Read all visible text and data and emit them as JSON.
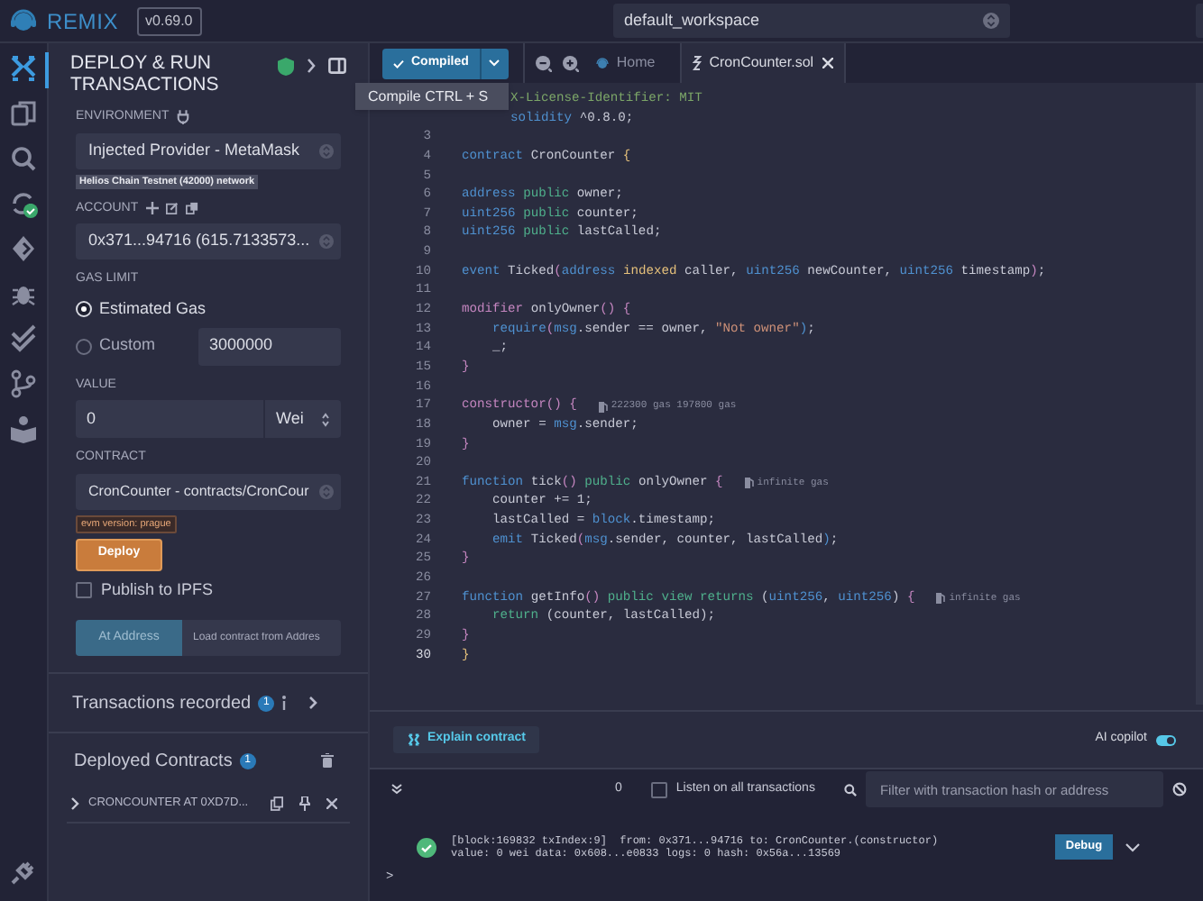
{
  "top_bar": {
    "logo": "REMIX",
    "version": "v0.69.0",
    "workspace": "default_workspace"
  },
  "side_panel": {
    "title": "DEPLOY & RUN TRANSACTIONS",
    "environment": {
      "label": "ENVIRONMENT",
      "value": "Injected Provider - MetaMask",
      "network": "Helios Chain Testnet (42000) network"
    },
    "account": {
      "label": "ACCOUNT",
      "value": "0x371...94716 (615.7133573..."
    },
    "gas_limit": {
      "label": "GAS LIMIT",
      "options": [
        {
          "label": "Estimated Gas",
          "selected": true
        },
        {
          "label": "Custom",
          "selected": false
        }
      ],
      "custom_value": "3000000"
    },
    "value": {
      "label": "VALUE",
      "amount": "0",
      "unit": "Wei"
    },
    "contract": {
      "label": "CONTRACT",
      "value": "CronCounter - contracts/CronCour",
      "evm_badge": "evm version: prague"
    },
    "deploy_button": "Deploy",
    "publish": {
      "label": "Publish to IPFS",
      "checked": false
    },
    "at_address": {
      "button": "At Address",
      "placeholder": "Load contract from Addres"
    },
    "transactions_recorded": {
      "label": "Transactions recorded",
      "count": "1"
    },
    "deployed_contracts": {
      "label": "Deployed Contracts",
      "count": "1",
      "items": [
        {
          "name": "CRONCOUNTER AT 0XD7D..."
        }
      ]
    }
  },
  "editor": {
    "compile_button": "Compiled",
    "tooltip": "Compile CTRL + S",
    "tabs": [
      {
        "label": "Home",
        "selected": false
      },
      {
        "label": "CronCounter.sol",
        "selected": true
      }
    ],
    "lines": [
      {
        "tokens": [
          {
            "text": "X-License-Identifier: MIT",
            "kind": "comment"
          }
        ]
      },
      {
        "tokens": [
          {
            "text": "solidity",
            "kind": "type"
          },
          {
            "text": " ^0.8.0;",
            "kind": "plain"
          }
        ]
      },
      {
        "number": "3"
      },
      {
        "number": "4",
        "tokens": [
          {
            "text": "contract",
            "kind": "type"
          },
          {
            "text": " CronCounter ",
            "kind": "plain"
          },
          {
            "text": "{",
            "kind": "bracket"
          }
        ]
      },
      {
        "number": "5"
      },
      {
        "number": "6",
        "tokens": [
          {
            "text": "address",
            "kind": "type"
          },
          {
            "text": " public",
            "kind": "visibility"
          },
          {
            "text": " owner;",
            "kind": "plain"
          }
        ]
      },
      {
        "number": "7",
        "tokens": [
          {
            "text": "uint256",
            "kind": "type"
          },
          {
            "text": " public",
            "kind": "visibility"
          },
          {
            "text": " counter;",
            "kind": "plain"
          }
        ]
      },
      {
        "number": "8",
        "tokens": [
          {
            "text": "uint256",
            "kind": "type"
          },
          {
            "text": " public",
            "kind": "visibility"
          },
          {
            "text": " lastCalled;",
            "kind": "plain"
          }
        ]
      },
      {
        "number": "9"
      },
      {
        "number": "10",
        "tokens": [
          {
            "text": "event",
            "kind": "type"
          },
          {
            "text": " Ticked",
            "kind": "plain"
          },
          {
            "text": "(",
            "kind": "paren"
          },
          {
            "text": "address",
            "kind": "type"
          },
          {
            "text": " indexed",
            "kind": "bracket"
          },
          {
            "text": " caller, ",
            "kind": "plain"
          },
          {
            "text": "uint256",
            "kind": "type"
          },
          {
            "text": " newCounter, ",
            "kind": "plain"
          },
          {
            "text": "uint256",
            "kind": "type"
          },
          {
            "text": " timestamp",
            "kind": "plain"
          },
          {
            "text": ")",
            "kind": "paren"
          },
          {
            "text": ";",
            "kind": "plain"
          }
        ]
      },
      {
        "number": "11"
      },
      {
        "number": "12",
        "tokens": [
          {
            "text": "modifier",
            "kind": "paren"
          },
          {
            "text": " onlyOwner",
            "kind": "plain"
          },
          {
            "text": "()",
            "kind": "paren"
          },
          {
            "text": " {",
            "kind": "paren"
          }
        ]
      },
      {
        "number": "13",
        "tokens": [
          {
            "text": "    require",
            "kind": "type"
          },
          {
            "text": "(",
            "kind": "paren"
          },
          {
            "text": "msg",
            "kind": "type"
          },
          {
            "text": ".sender == owner, ",
            "kind": "plain"
          },
          {
            "text": "\"Not owner\"",
            "kind": "string"
          },
          {
            "text": ")",
            "kind": "type"
          },
          {
            "text": ";",
            "kind": "plain"
          }
        ]
      },
      {
        "number": "14",
        "tokens": [
          {
            "text": "    _;",
            "kind": "plain"
          }
        ]
      },
      {
        "number": "15",
        "tokens": [
          {
            "text": "}",
            "kind": "paren"
          }
        ]
      },
      {
        "number": "16"
      },
      {
        "number": "17",
        "tokens": [
          {
            "text": "constructor",
            "kind": "paren"
          },
          {
            "text": "() {",
            "kind": "paren"
          }
        ],
        "hint": "222300 gas 197800 gas"
      },
      {
        "number": "18",
        "tokens": [
          {
            "text": "    owner = ",
            "kind": "plain"
          },
          {
            "text": "msg",
            "kind": "type"
          },
          {
            "text": ".sender;",
            "kind": "plain"
          }
        ]
      },
      {
        "number": "19",
        "tokens": [
          {
            "text": "}",
            "kind": "paren"
          }
        ]
      },
      {
        "number": "20"
      },
      {
        "number": "21",
        "tokens": [
          {
            "text": "function",
            "kind": "type"
          },
          {
            "text": " tick",
            "kind": "plain"
          },
          {
            "text": "()",
            "kind": "paren"
          },
          {
            "text": " public",
            "kind": "visibility"
          },
          {
            "text": " onlyOwner ",
            "kind": "plain"
          },
          {
            "text": "{",
            "kind": "paren"
          }
        ],
        "hint": "infinite gas"
      },
      {
        "number": "22",
        "tokens": [
          {
            "text": "    counter += 1;",
            "kind": "plain"
          }
        ]
      },
      {
        "number": "23",
        "tokens": [
          {
            "text": "    lastCalled = ",
            "kind": "plain"
          },
          {
            "text": "block",
            "kind": "type"
          },
          {
            "text": ".timestamp;",
            "kind": "plain"
          }
        ]
      },
      {
        "number": "24",
        "tokens": [
          {
            "text": "    emit",
            "kind": "type"
          },
          {
            "text": " Ticked",
            "kind": "plain"
          },
          {
            "text": "(",
            "kind": "paren"
          },
          {
            "text": "msg",
            "kind": "type"
          },
          {
            "text": ".sender, counter, lastCalled",
            "kind": "plain"
          },
          {
            "text": ")",
            "kind": "type"
          },
          {
            "text": ";",
            "kind": "plain"
          }
        ]
      },
      {
        "number": "25",
        "tokens": [
          {
            "text": "}",
            "kind": "paren"
          }
        ]
      },
      {
        "number": "26"
      },
      {
        "number": "27",
        "tokens": [
          {
            "text": "function",
            "kind": "type"
          },
          {
            "text": " getInfo",
            "kind": "plain"
          },
          {
            "text": "()",
            "kind": "paren"
          },
          {
            "text": " public view returns",
            "kind": "visibility"
          },
          {
            "text": " (",
            "kind": "plain"
          },
          {
            "text": "uint256",
            "kind": "type"
          },
          {
            "text": ", ",
            "kind": "plain"
          },
          {
            "text": "uint256",
            "kind": "type"
          },
          {
            "text": ") ",
            "kind": "plain"
          },
          {
            "text": "{",
            "kind": "paren"
          }
        ],
        "hint": "infinite gas"
      },
      {
        "number": "28",
        "tokens": [
          {
            "text": "    return",
            "kind": "visibility"
          },
          {
            "text": " (counter, lastCalled);",
            "kind": "plain"
          }
        ]
      },
      {
        "number": "29",
        "tokens": [
          {
            "text": "}",
            "kind": "paren"
          }
        ]
      },
      {
        "number": "30",
        "tokens": [
          {
            "text": "}",
            "kind": "bracket"
          }
        ]
      }
    ]
  },
  "bottom_panel": {
    "explain_button": "Explain contract",
    "ai_copilot": {
      "label": "AI copilot",
      "on": true
    },
    "terminal": {
      "count": "0",
      "listen": {
        "label": "Listen on all transactions",
        "checked": false
      },
      "filter_placeholder": "Filter with transaction hash or address",
      "log": [
        {
          "line_1": "[block:169832 txIndex:9]  from: 0x371...94716 to: CronCounter.(constructor)",
          "line_2": "value: 0 wei data: 0x608...e0833 logs: 0 hash: 0x56a...13569",
          "button": "Debug"
        }
      ],
      "prompt": ">"
    }
  }
}
